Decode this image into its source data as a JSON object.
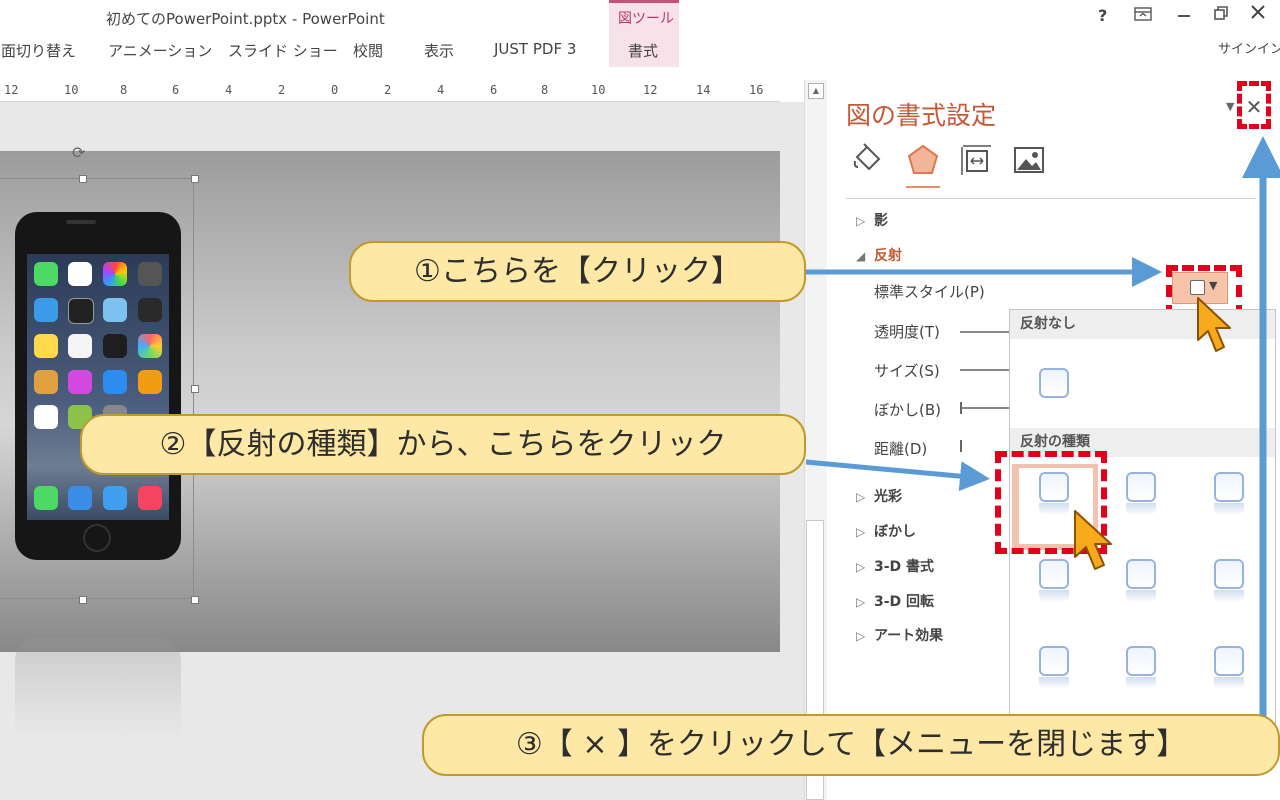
{
  "window": {
    "title": "初めてのPowerPoint.pptx - PowerPoint",
    "help": "?",
    "signin": "サインイン"
  },
  "ribbon": {
    "tabs": [
      "画面切り替え",
      "アニメーション",
      "スライド ショー",
      "校閲",
      "表示",
      "JUST PDF 3"
    ],
    "tool_group_label": "図ツール",
    "tool_tab": "書式"
  },
  "ruler": {
    "labels": [
      "12",
      "10",
      "8",
      "6",
      "4",
      "2",
      "0",
      "2",
      "4",
      "6",
      "8",
      "10",
      "12",
      "14",
      "16"
    ]
  },
  "pane": {
    "title": "図の書式設定",
    "close_symbol": "✕",
    "tab_icons": [
      "fill-line-icon",
      "effects-pentagon-icon",
      "size-properties-icon",
      "picture-icon"
    ],
    "sections": {
      "shadow": "影",
      "reflection": "反射",
      "glow": "光彩",
      "soft_edges": "ぼかし",
      "format_3d": "3-D 書式",
      "rotation_3d": "3-D 回転",
      "art_effects": "アート効果"
    },
    "reflection_options": {
      "preset": "標準スタイル(P)",
      "transparency": "透明度(T)",
      "size": "サイズ(S)",
      "blur": "ぼかし(B)",
      "distance": "距離(D)"
    }
  },
  "gallery": {
    "no_reflection_header": "反射なし",
    "variations_header": "反射の種類"
  },
  "callouts": {
    "step1": "①こちらを【クリック】",
    "step2": "②【反射の種類】から、こちらをクリック",
    "step3": "③【 × 】をクリックして【メニューを閉じます】"
  },
  "colors": {
    "accent_orange": "#c35a35",
    "highlight_red": "#e3001b",
    "callout_fill": "#fde8a5",
    "arrow_blue": "#5b9bd5",
    "tool_tab_pink": "#c9507a"
  }
}
